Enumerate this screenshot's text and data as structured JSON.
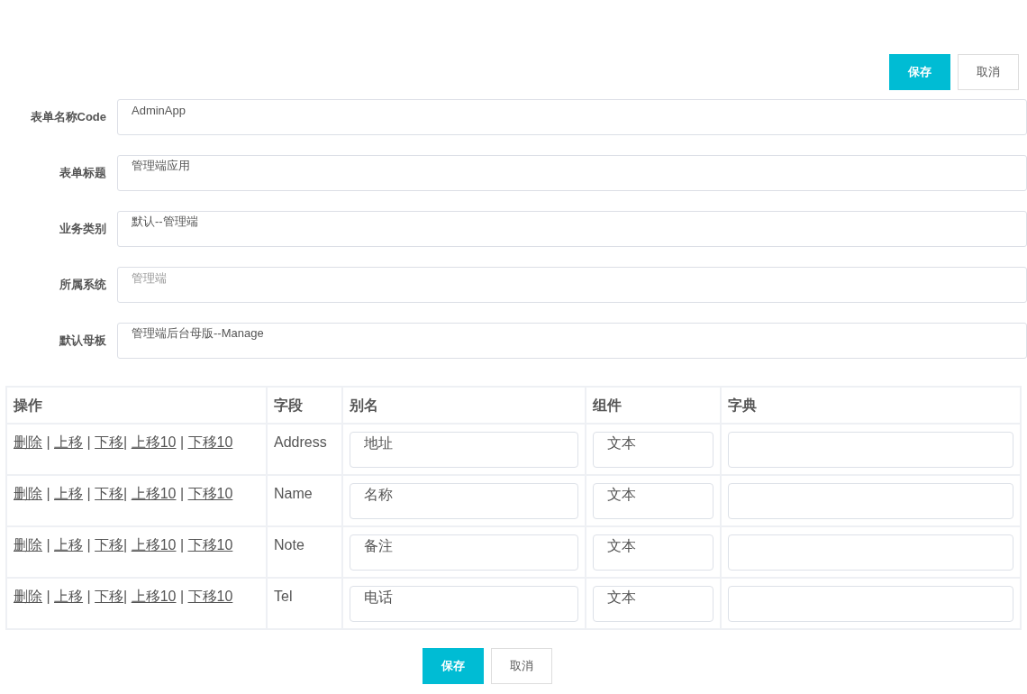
{
  "top_actions": [
    {
      "label": "保存",
      "kind": "primary"
    },
    {
      "label": "取消",
      "kind": "secondary"
    }
  ],
  "form_fields": [
    {
      "label": "表单名称Code",
      "value": "AdminApp"
    },
    {
      "label": "表单标题",
      "value": "管理端应用"
    },
    {
      "label": "业务类别",
      "value": "默认--管理端"
    },
    {
      "label": "所属系统",
      "placeholder": "管理端"
    },
    {
      "label": "默认母板",
      "value": "管理端后台母版--Manage"
    }
  ],
  "table": {
    "columns": [
      "操作",
      "字段",
      "别名",
      "组件",
      "字典"
    ],
    "rows": [
      {
        "actions": [
          "删除",
          " | ",
          "上移",
          " | ",
          "下移",
          "| ",
          "上移10",
          " | ",
          "下移10"
        ],
        "field": "Address",
        "alias": "地址",
        "component": "文本",
        "dictionary": ""
      },
      {
        "actions": [
          "删除",
          " | ",
          "上移",
          " | ",
          "下移",
          "| ",
          "上移10",
          " | ",
          "下移10"
        ],
        "field": "Name",
        "alias": "名称",
        "component": "文本",
        "dictionary": ""
      },
      {
        "actions": [
          "删除",
          " | ",
          "上移",
          " | ",
          "下移",
          "| ",
          "上移10",
          " | ",
          "下移10"
        ],
        "field": "Note",
        "alias": "备注",
        "component": "文本",
        "dictionary": ""
      },
      {
        "actions": [
          "删除",
          " | ",
          "上移",
          " | ",
          "下移",
          "| ",
          "上移10",
          " | ",
          "下移10"
        ],
        "field": "Tel",
        "alias": "电话",
        "component": "文本",
        "dictionary": ""
      }
    ]
  },
  "bottom_actions": [
    {
      "label": "保存",
      "kind": "primary"
    },
    {
      "label": "取消",
      "kind": "secondary"
    }
  ]
}
